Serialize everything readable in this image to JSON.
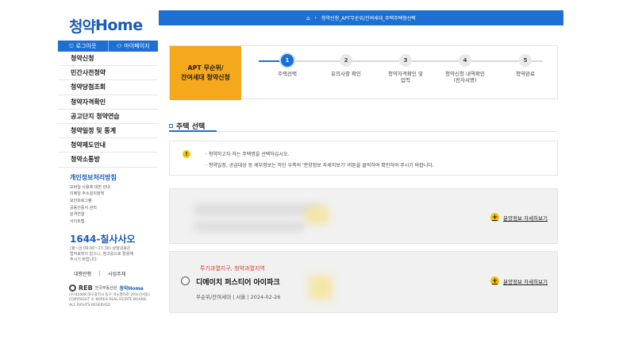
{
  "sidebar": {
    "logo_ko": "청약",
    "logo_en": "Home",
    "logout_label": "로그아웃",
    "mypage_label": "마이페이지",
    "nav_items": [
      "청약신청",
      "민간사전청약",
      "청약당첨조회",
      "청약자격확인",
      "공고단지 청약연습",
      "청약일정 및 통계",
      "청약제도안내",
      "청약소통방"
    ],
    "privacy_title": "개인정보처리방침",
    "sub_links": [
      "모바일 사용에 대한 안내",
      "이메일 주소침지정책",
      "보안프로그램",
      "공동인증서 관리",
      "원격연결",
      "사이트맵"
    ],
    "cs_phone": "1644-칠사사오",
    "cs_lines": [
      "(평~금 09:00~17:30) 상담내용은",
      "법적효력이 없으니, 참고용으로 활용해",
      "주시기 바랍니다."
    ],
    "util_links": [
      "대행관행",
      "사업주체"
    ],
    "footer_reb": "REB",
    "footer_small": "한국부동산원",
    "footer_sub": "청약Home",
    "footer_lines": [
      "(우)41068 대구광역시 동구 이노밸리로 291(신서동)",
      "COPYRIGHT © KOREA REAL ESTATE BOARD.",
      "ALL RIGHTS RESERVED"
    ]
  },
  "breadcrumb": {
    "path": "청약신청_APT무순위/잔여세대_주택주택형선택"
  },
  "steps": {
    "label_line1": "APT 무순위/",
    "label_line2": "잔여세대 청약신청",
    "items": [
      {
        "num": "1",
        "label_line1": "주택선택",
        "label_line2": ""
      },
      {
        "num": "2",
        "label_line1": "유의사항 확인",
        "label_line2": ""
      },
      {
        "num": "3",
        "label_line1": "청약자격확인 및",
        "label_line2": "입력"
      },
      {
        "num": "4",
        "label_line1": "청약신청 내역확인",
        "label_line2": "(전자서명)"
      },
      {
        "num": "5",
        "label_line1": "청약완료",
        "label_line2": ""
      }
    ],
    "active_index": 0
  },
  "section": {
    "title": "주택 선택"
  },
  "notice": {
    "icon": "!",
    "line1": "· 청약하고자 하는 주택명을 선택하십시오.",
    "line2": "· 청약일정, 공급대상 등 세부정보는 하단 우측의 '분양정보 자세히보기' 버튼을 클릭하여 확인하여 주시기 바랍니다."
  },
  "cards": [
    {
      "tag": "",
      "name": "",
      "meta": "",
      "link_label": "분양정보 자세히보기"
    },
    {
      "tag": "투기과열지구, 청약과열지역",
      "name": "디에이치 퍼스티어 아이파크",
      "meta": "무순위/잔여세대 | 서울 | 2024-02-26",
      "link_label": "분양정보 자세히보기"
    }
  ],
  "colors": {
    "primary": "#1d6fd1",
    "step_label_bg": "#f5a81c",
    "tag_red": "#d43a2c",
    "plus_yellow": "#f5c400"
  },
  "icons": {
    "logout": "logout-icon",
    "mypage": "user-icon",
    "home": "home-icon",
    "notice": "warning-icon",
    "detail": "plus-icon"
  }
}
